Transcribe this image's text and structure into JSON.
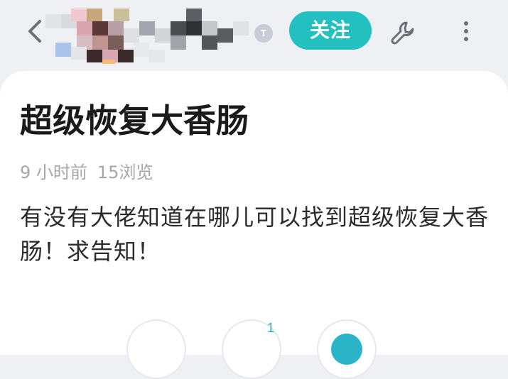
{
  "header": {
    "back_icon": "chevron-left-icon",
    "user_badge_text": "T",
    "follow_label": "关注",
    "follow_color": "#22c0c0",
    "settings_icon": "wrench-icon",
    "more_icon": "more-vertical-icon"
  },
  "post": {
    "title": "超级恢复大香肠",
    "time_ago": "9 小时前",
    "views": "15浏览",
    "body": "有没有大佬知道在哪儿可以找到超级恢复大香肠！求告知！"
  },
  "actions": {
    "count_badge": "1",
    "accent_color": "#2bb3c8"
  }
}
